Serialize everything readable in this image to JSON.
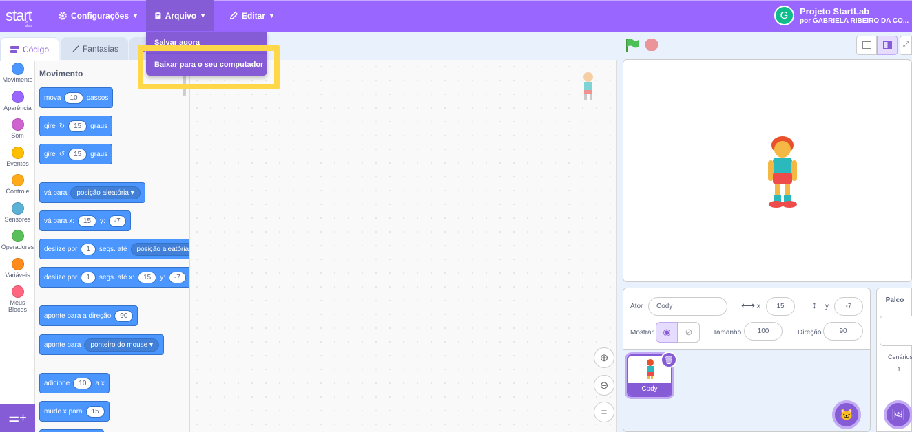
{
  "app": {
    "logo": "start",
    "logo_sub": "by alura"
  },
  "menu": {
    "settings": "Configurações",
    "file": "Arquivo",
    "edit": "Editar"
  },
  "file_menu": {
    "items": [
      "Salvar agora",
      "Baixar para o seu computador"
    ]
  },
  "project": {
    "avatar_letter": "G",
    "title": "Projeto StartLab",
    "author": "por GABRIELA RIBEIRO DA CO..."
  },
  "tabs": {
    "code": "Código",
    "costumes": "Fantasias"
  },
  "categories": [
    {
      "label": "Movimento",
      "color": "#4c97ff"
    },
    {
      "label": "Aparência",
      "color": "#9966ff"
    },
    {
      "label": "Som",
      "color": "#cf63cf"
    },
    {
      "label": "Eventos",
      "color": "#ffbf00"
    },
    {
      "label": "Controle",
      "color": "#ffab19"
    },
    {
      "label": "Sensores",
      "color": "#5cb1d6"
    },
    {
      "label": "Operadores",
      "color": "#59c059"
    },
    {
      "label": "Variáveis",
      "color": "#ff8c1a"
    },
    {
      "label": "Meus Blocos",
      "color": "#ff6680"
    }
  ],
  "palette": {
    "title": "Movimento",
    "b1": {
      "a": "mova",
      "v": "10",
      "b": "passos"
    },
    "b2": {
      "a": "gire",
      "v": "15",
      "b": "graus"
    },
    "b3": {
      "a": "gire",
      "v": "15",
      "b": "graus"
    },
    "b4": {
      "a": "vá para",
      "d": "posição aleatória"
    },
    "b5": {
      "a": "vá para x:",
      "x": "15",
      "b": "y:",
      "y": "-7"
    },
    "b6": {
      "a": "deslize por",
      "v": "1",
      "b": "segs. até",
      "d": "posição aleatória"
    },
    "b7": {
      "a": "deslize por",
      "v": "1",
      "b": "segs. até x:",
      "x": "15",
      "c": "y:",
      "y": "-7"
    },
    "b8": {
      "a": "aponte para a direção",
      "v": "90"
    },
    "b9": {
      "a": "aponte para",
      "d": "ponteiro do mouse"
    },
    "b10": {
      "a": "adicione",
      "v": "10",
      "b": "a x"
    },
    "b11": {
      "a": "mude x para",
      "v": "15"
    }
  },
  "sprite": {
    "label_actor": "Ator",
    "name": "Cody",
    "x_label": "x",
    "x": "15",
    "y_label": "y",
    "y": "-7",
    "show_label": "Mostrar",
    "size_label": "Tamanho",
    "size": "100",
    "dir_label": "Direção",
    "dir": "90",
    "thumb_name": "Cody"
  },
  "stage_pane": {
    "title": "Palco",
    "backdrops_label": "Cenários",
    "backdrops_count": "1"
  },
  "colors": {
    "primary": "#9966ff",
    "menu_active": "#855cd6",
    "highlight": "#ffd84a",
    "motion": "#4c97ff"
  }
}
